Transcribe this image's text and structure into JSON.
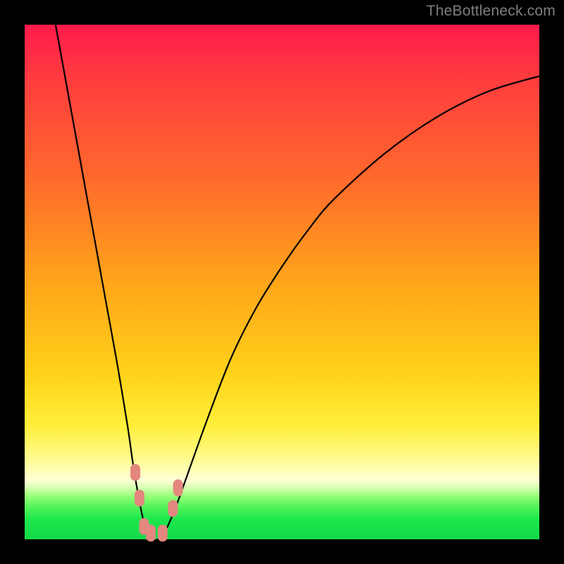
{
  "watermark": "TheBottleneck.com",
  "chart_data": {
    "type": "line",
    "title": "",
    "xlabel": "",
    "ylabel": "",
    "xlim": [
      0,
      100
    ],
    "ylim": [
      0,
      100
    ],
    "grid": false,
    "legend": false,
    "series": [
      {
        "name": "bottleneck-curve",
        "x": [
          6,
          8,
          10,
          12,
          14,
          16,
          18,
          20,
          21,
          22,
          23,
          24,
          25,
          26,
          27,
          28,
          30,
          35,
          40,
          45,
          50,
          55,
          60,
          70,
          80,
          90,
          100
        ],
        "y": [
          100,
          89,
          78,
          67,
          56,
          45,
          34,
          22,
          15,
          9,
          4,
          1,
          0,
          0,
          1,
          3,
          8,
          22,
          35,
          45,
          53,
          60,
          66,
          75,
          82,
          87,
          90
        ]
      }
    ],
    "markers": [
      {
        "name": "left-slope-marker-1",
        "x": 21.5,
        "y": 13,
        "color": "#e3877f"
      },
      {
        "name": "left-slope-marker-2",
        "x": 22.3,
        "y": 8,
        "color": "#e3877f"
      },
      {
        "name": "trough-marker-1",
        "x": 23.2,
        "y": 2.5,
        "color": "#e3877f"
      },
      {
        "name": "trough-marker-2",
        "x": 24.5,
        "y": 1.2,
        "color": "#e3877f"
      },
      {
        "name": "trough-marker-3",
        "x": 26.8,
        "y": 1.2,
        "color": "#e3877f"
      },
      {
        "name": "right-slope-marker-1",
        "x": 28.8,
        "y": 6,
        "color": "#e3877f"
      },
      {
        "name": "right-slope-marker-2",
        "x": 29.8,
        "y": 10,
        "color": "#e3877f"
      }
    ],
    "background_gradient": {
      "top": "#ff1a4c",
      "upper_mid": "#ffa519",
      "lower_mid": "#ffef3a",
      "bottom": "#13d948"
    }
  }
}
